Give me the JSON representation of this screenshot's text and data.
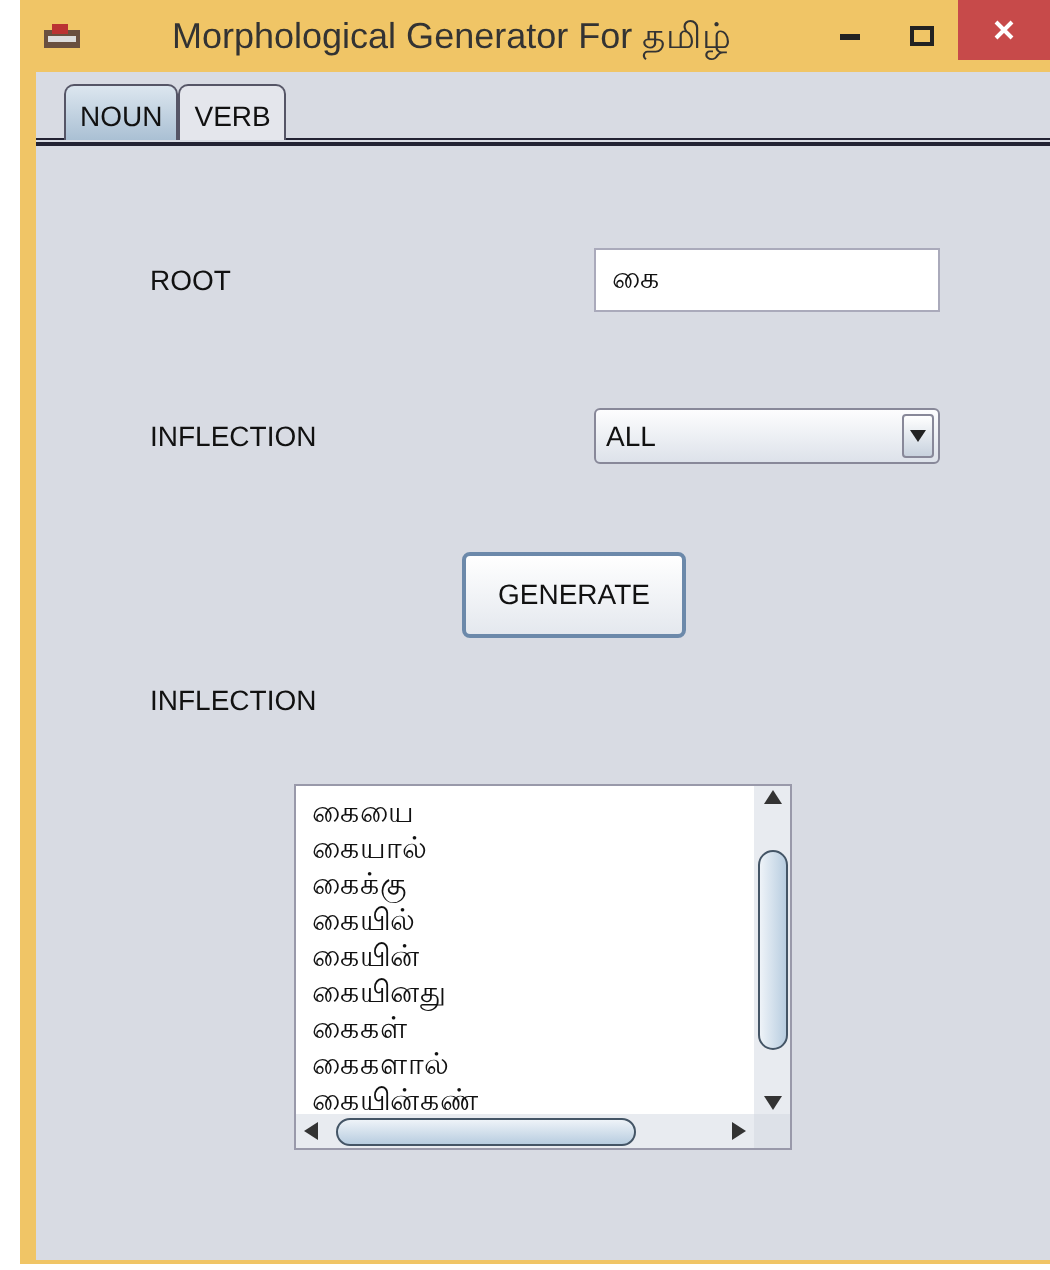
{
  "window": {
    "title": "Morphological Generator For தமிழ்"
  },
  "tabs": [
    {
      "label": "NOUN",
      "selected": true
    },
    {
      "label": "VERB",
      "selected": false
    }
  ],
  "form": {
    "root_label": "ROOT",
    "root_value": "கை",
    "inflection_label": "INFLECTION",
    "inflection_value": "ALL",
    "button": "GENERATE"
  },
  "results": {
    "label": "INFLECTION",
    "items": [
      "கையை",
      "கையால்",
      "கைக்கு",
      "கையில்",
      "கையின்",
      "கையினது",
      "கைகள்",
      "கைகளால்",
      "கையின்கண்"
    ]
  }
}
